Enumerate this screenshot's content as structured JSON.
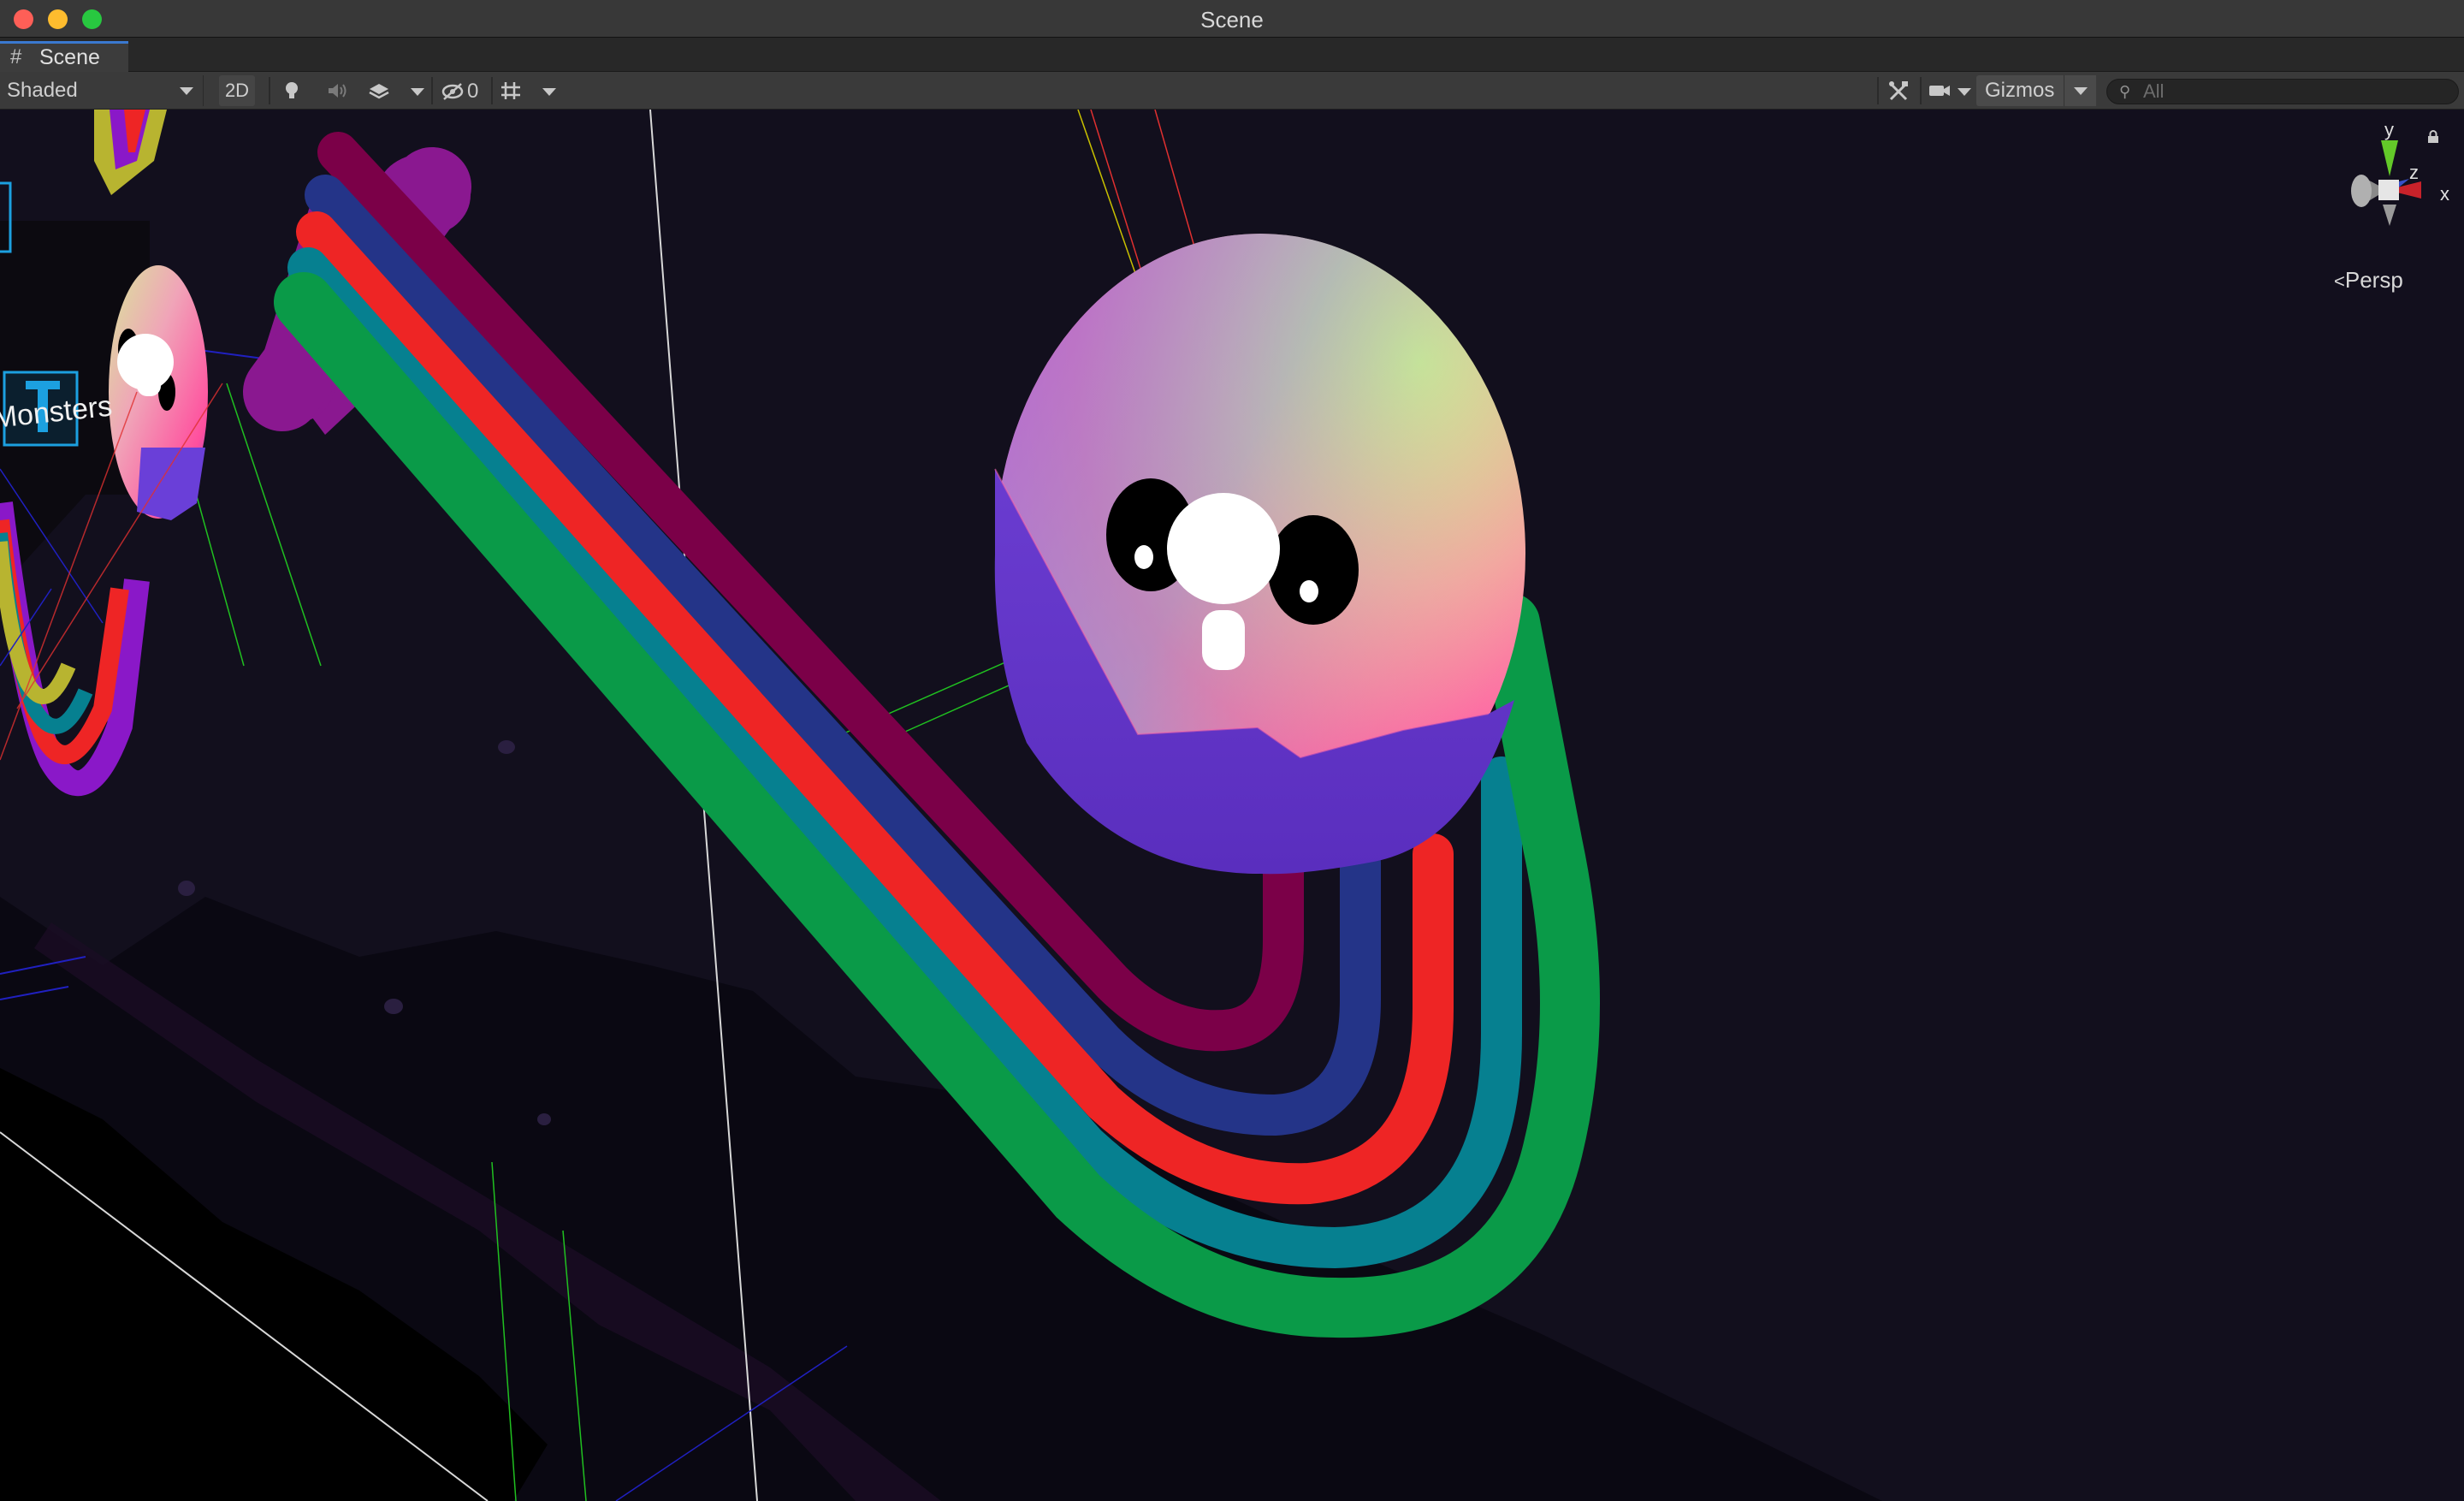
{
  "window": {
    "title": "Scene"
  },
  "tab": {
    "icon": "hash-icon",
    "label": "Scene"
  },
  "toolbar": {
    "draw_mode": "Shaded",
    "mode_2d": "2D",
    "hidden_count": "0",
    "gizmos_label": "Gizmos",
    "search_placeholder": "All"
  },
  "orientation_gizmo": {
    "axis_y": "y",
    "axis_z": "z",
    "axis_x": "x",
    "projection_label": "Persp"
  },
  "scene": {
    "text_object": "Monsters",
    "colors": {
      "background": "#120f1d",
      "stripe_maroon": "#7b0048",
      "stripe_blue": "#243488",
      "stripe_red": "#ee2525",
      "stripe_teal": "#068090",
      "stripe_green": "#0a9a48",
      "creature_pink": "#ff4fa0",
      "creature_purple": "#5a2ec8"
    }
  }
}
